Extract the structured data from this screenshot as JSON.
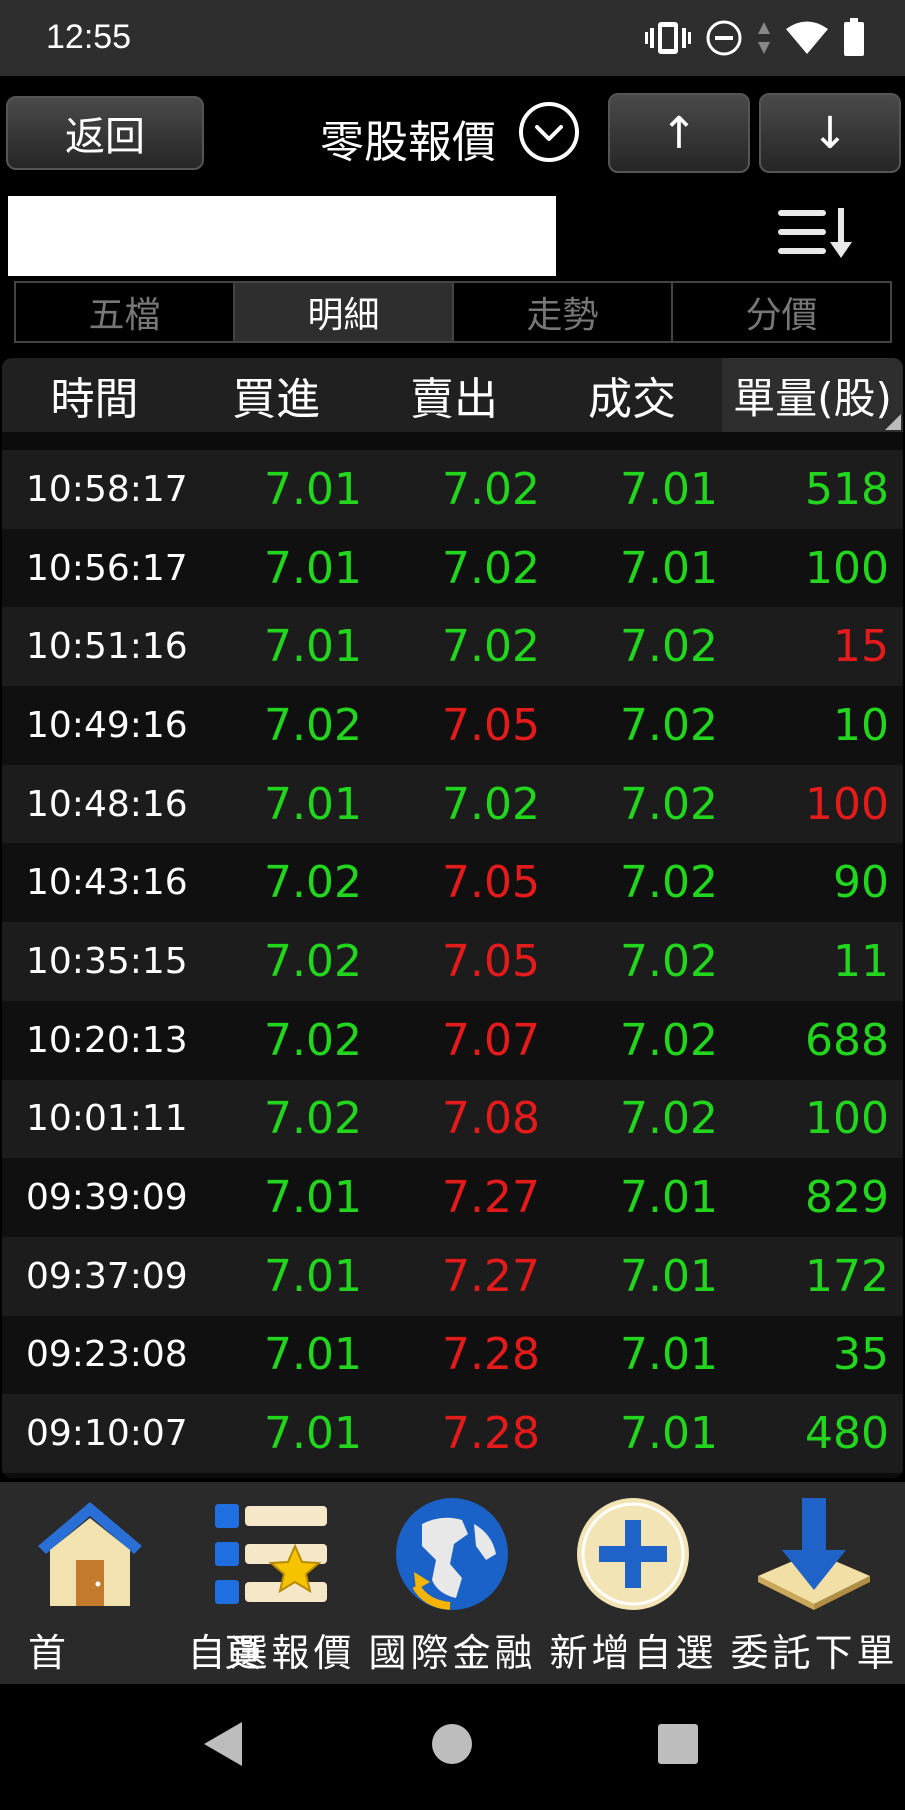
{
  "status": {
    "time": "12:55"
  },
  "toolbar": {
    "back_label": "返回",
    "title": "零股報價",
    "up_label": "↑",
    "down_label": "↓"
  },
  "tabs": [
    {
      "label": "五檔",
      "active": false
    },
    {
      "label": "明細",
      "active": true
    },
    {
      "label": "走勢",
      "active": false
    },
    {
      "label": "分價",
      "active": false
    }
  ],
  "table": {
    "headers": {
      "time": "時間",
      "bid": "買進",
      "ask": "賣出",
      "deal": "成交",
      "qty": "單量(股)"
    },
    "rows": [
      {
        "time": "10:58:17",
        "bid": "7.01",
        "ask": "7.02",
        "deal": "7.01",
        "qty": "518",
        "bid_color": "green",
        "ask_color": "green",
        "deal_color": "green",
        "qty_color": "green"
      },
      {
        "time": "10:56:17",
        "bid": "7.01",
        "ask": "7.02",
        "deal": "7.01",
        "qty": "100",
        "bid_color": "green",
        "ask_color": "green",
        "deal_color": "green",
        "qty_color": "green"
      },
      {
        "time": "10:51:16",
        "bid": "7.01",
        "ask": "7.02",
        "deal": "7.02",
        "qty": "15",
        "bid_color": "green",
        "ask_color": "green",
        "deal_color": "green",
        "qty_color": "red"
      },
      {
        "time": "10:49:16",
        "bid": "7.02",
        "ask": "7.05",
        "deal": "7.02",
        "qty": "10",
        "bid_color": "green",
        "ask_color": "red",
        "deal_color": "green",
        "qty_color": "green"
      },
      {
        "time": "10:48:16",
        "bid": "7.01",
        "ask": "7.02",
        "deal": "7.02",
        "qty": "100",
        "bid_color": "green",
        "ask_color": "green",
        "deal_color": "green",
        "qty_color": "red"
      },
      {
        "time": "10:43:16",
        "bid": "7.02",
        "ask": "7.05",
        "deal": "7.02",
        "qty": "90",
        "bid_color": "green",
        "ask_color": "red",
        "deal_color": "green",
        "qty_color": "green"
      },
      {
        "time": "10:35:15",
        "bid": "7.02",
        "ask": "7.05",
        "deal": "7.02",
        "qty": "11",
        "bid_color": "green",
        "ask_color": "red",
        "deal_color": "green",
        "qty_color": "green"
      },
      {
        "time": "10:20:13",
        "bid": "7.02",
        "ask": "7.07",
        "deal": "7.02",
        "qty": "688",
        "bid_color": "green",
        "ask_color": "red",
        "deal_color": "green",
        "qty_color": "green"
      },
      {
        "time": "10:01:11",
        "bid": "7.02",
        "ask": "7.08",
        "deal": "7.02",
        "qty": "100",
        "bid_color": "green",
        "ask_color": "red",
        "deal_color": "green",
        "qty_color": "green"
      },
      {
        "time": "09:39:09",
        "bid": "7.01",
        "ask": "7.27",
        "deal": "7.01",
        "qty": "829",
        "bid_color": "green",
        "ask_color": "red",
        "deal_color": "green",
        "qty_color": "green"
      },
      {
        "time": "09:37:09",
        "bid": "7.01",
        "ask": "7.27",
        "deal": "7.01",
        "qty": "172",
        "bid_color": "green",
        "ask_color": "red",
        "deal_color": "green",
        "qty_color": "green"
      },
      {
        "time": "09:23:08",
        "bid": "7.01",
        "ask": "7.28",
        "deal": "7.01",
        "qty": "35",
        "bid_color": "green",
        "ask_color": "red",
        "deal_color": "green",
        "qty_color": "green"
      },
      {
        "time": "09:10:07",
        "bid": "7.01",
        "ask": "7.28",
        "deal": "7.01",
        "qty": "480",
        "bid_color": "green",
        "ask_color": "red",
        "deal_color": "green",
        "qty_color": "green"
      }
    ]
  },
  "bottom_nav": [
    {
      "label": "首　頁",
      "icon": "home-icon"
    },
    {
      "label": "自選報價",
      "icon": "watchlist-icon"
    },
    {
      "label": "國際金融",
      "icon": "globe-icon"
    },
    {
      "label": "新增自選",
      "icon": "add-icon"
    },
    {
      "label": "委託下單",
      "icon": "order-icon"
    }
  ],
  "colors": {
    "up": "#e51b1b",
    "down": "#22d61e",
    "background": "#000000"
  }
}
